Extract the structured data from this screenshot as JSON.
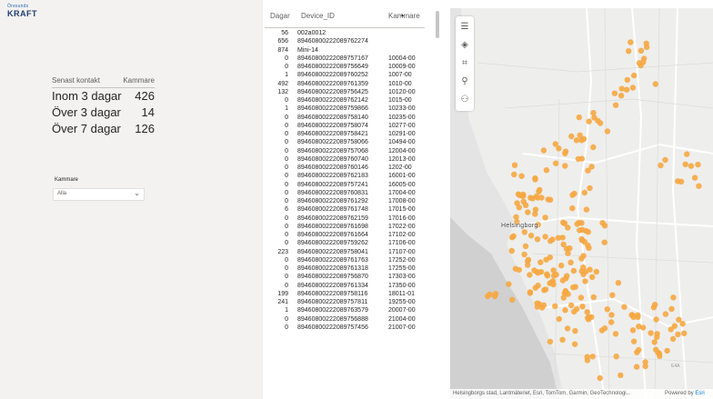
{
  "logo": {
    "top_text": "Öresunds",
    "main_text": "KRAFT"
  },
  "summary": {
    "col_label": "Senast kontakt",
    "col_value": "Kammare",
    "rows": [
      {
        "label": "Inom 3 dagar",
        "value": "426"
      },
      {
        "label": "Över 3 dagar",
        "value": "14"
      },
      {
        "label": "Över 7 dagar",
        "value": "126"
      }
    ]
  },
  "slicer": {
    "title": "Kammare",
    "value": "Alla"
  },
  "table": {
    "columns": [
      "Dagar",
      "Device_ID",
      "Kammare"
    ],
    "rows": [
      [
        "56",
        "002a0012",
        ""
      ],
      [
        "656",
        "89460800222089762274",
        ""
      ],
      [
        "874",
        "Mini-14",
        ""
      ],
      [
        "0",
        "89460800222089757167",
        "10004-00"
      ],
      [
        "0",
        "89460800222089756649",
        "10009-00"
      ],
      [
        "1",
        "89460800222089760252",
        "1007-00"
      ],
      [
        "492",
        "89460800222089761359",
        "1010-00"
      ],
      [
        "132",
        "89460800222089756425",
        "10120-00"
      ],
      [
        "0",
        "89460800222089762142",
        "1015-00"
      ],
      [
        "1",
        "89460800222089759866",
        "10233-00"
      ],
      [
        "0",
        "89460800222089758140",
        "10235-00"
      ],
      [
        "0",
        "89460800222089758074",
        "10277-00"
      ],
      [
        "0",
        "89460800222089758421",
        "10291-00"
      ],
      [
        "0",
        "89460800222089758066",
        "10494-00"
      ],
      [
        "0",
        "89460800222089757068",
        "12004-00"
      ],
      [
        "0",
        "89460800222089760740",
        "12013-00"
      ],
      [
        "0",
        "89460800222089760146",
        "1202-00"
      ],
      [
        "0",
        "89460800222089762183",
        "16001-00"
      ],
      [
        "0",
        "89460800222089757241",
        "16005-00"
      ],
      [
        "0",
        "89460800222089760831",
        "17004-00"
      ],
      [
        "0",
        "89460800222089761292",
        "17008-00"
      ],
      [
        "6",
        "89460800222089761748",
        "17015-00"
      ],
      [
        "0",
        "89460800222089762159",
        "17016-00"
      ],
      [
        "0",
        "89460800222089761698",
        "17022-00"
      ],
      [
        "0",
        "89460800222089761664",
        "17102-00"
      ],
      [
        "0",
        "89460800222089759262",
        "17106-00"
      ],
      [
        "223",
        "89460800222089758041",
        "17107-00"
      ],
      [
        "0",
        "89460800222089761763",
        "17252-00"
      ],
      [
        "0",
        "89460800222089761318",
        "17255-00"
      ],
      [
        "0",
        "89460800222089756870",
        "17303-00"
      ],
      [
        "0",
        "89460800222089761334",
        "17350-00"
      ],
      [
        "199",
        "89460800222089758116",
        "18011-01"
      ],
      [
        "241",
        "89460800222089757811",
        "19255-00"
      ],
      [
        "1",
        "89460800222089763579",
        "20007-00"
      ],
      [
        "0",
        "89460800222089756888",
        "21004-00"
      ],
      [
        "0",
        "89460800222089757456",
        "21007-00"
      ]
    ]
  },
  "map": {
    "city_label": "Helsingborg",
    "road_label": "E4A",
    "attribution": "Helsingborgs stad, Lantmäteriet, Esri, TomTom, Garmin, GeoTechnologi...",
    "powered_by_prefix": "Powered by ",
    "powered_by_link": "Esri",
    "marker_color": "#f5a742",
    "tools": [
      "menu-icon",
      "layers-icon",
      "selection-icon",
      "search-icon",
      "locate-icon"
    ]
  }
}
